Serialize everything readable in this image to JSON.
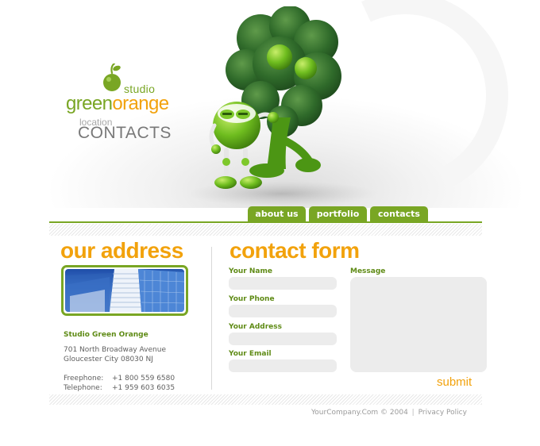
{
  "brand": {
    "studio": "studio",
    "name_green": "green",
    "name_orange": "orange",
    "page_label": "location",
    "page_title": "CONTACTS",
    "colors": {
      "green": "#79a624",
      "orange": "#f2a20c",
      "gray": "#787878"
    }
  },
  "nav": {
    "items": [
      {
        "label": "about us"
      },
      {
        "label": "portfolio"
      },
      {
        "label": "contacts"
      }
    ]
  },
  "address": {
    "heading": "our address",
    "company": "Studio Green Orange",
    "street": "701 North Broadway Avenue",
    "city": "Gloucester City 08030 NJ",
    "phones": [
      {
        "label": "Freephone:",
        "value": "+1 800 559 6580"
      },
      {
        "label": "Telephone:",
        "value": "+1 959 603 6035"
      }
    ]
  },
  "form": {
    "heading": "contact form",
    "fields": [
      {
        "label": "Your Name",
        "value": ""
      },
      {
        "label": "Your Phone",
        "value": ""
      },
      {
        "label": "Your Address",
        "value": ""
      },
      {
        "label": "Your Email",
        "value": ""
      }
    ],
    "message_label": "Message",
    "message_value": "",
    "submit_label": "submit"
  },
  "footer": {
    "copyright": "YourCompany.Com © 2004",
    "separator": "|",
    "privacy": "Privacy Policy"
  }
}
